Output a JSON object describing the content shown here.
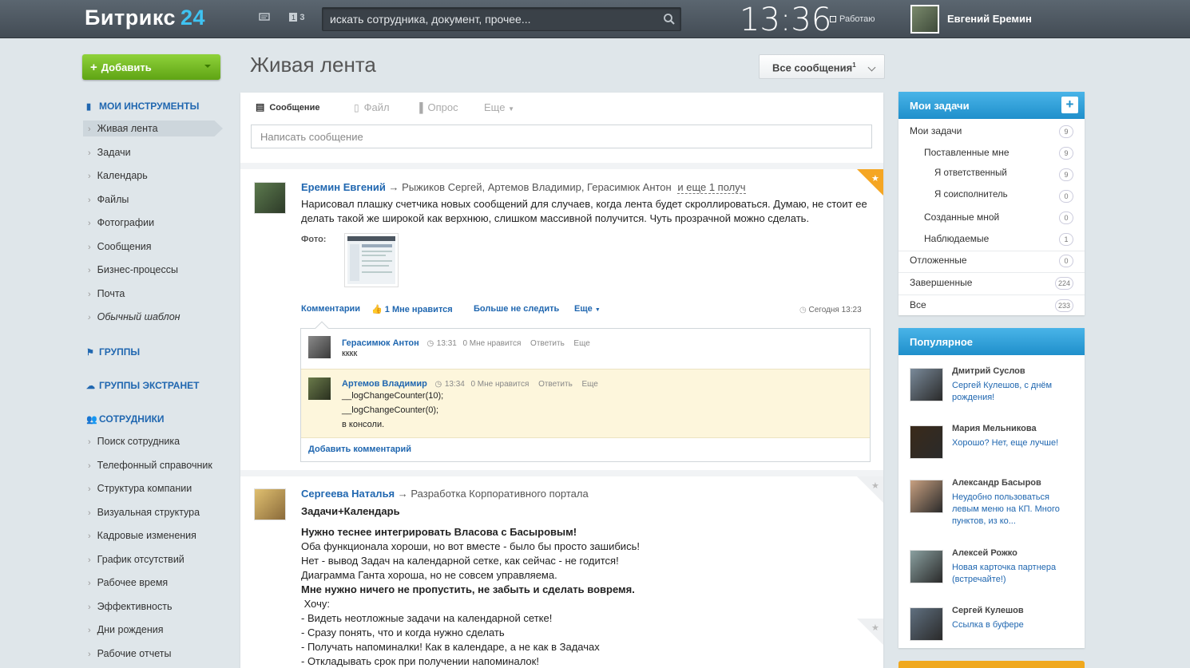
{
  "header": {
    "logo_text": "Битрикс",
    "logo_num": "24",
    "notif_count": "3",
    "search_placeholder": "искать сотрудника, документ, прочее...",
    "clock": "13:36",
    "status": "Работаю",
    "user_name": "Евгений Еремин"
  },
  "sidebar": {
    "add_button": "Добавить",
    "my_tools": "МОИ ИНСТРУМЕНТЫ",
    "tools": [
      "Живая лента",
      "Задачи",
      "Календарь",
      "Файлы",
      "Фотографии",
      "Сообщения",
      "Бизнес-процессы",
      "Почта",
      "Обычный шаблон"
    ],
    "groups": "ГРУППЫ",
    "ext_groups": "ГРУППЫ ЭКСТРАНЕТ",
    "employees": "СОТРУДНИКИ",
    "emp_items": [
      "Поиск сотрудника",
      "Телефонный справочник",
      "Структура компании",
      "Визуальная структура",
      "Кадровые изменения",
      "График отсутствий",
      "Рабочее время",
      "Эффективность",
      "Дни рождения",
      "Рабочие отчеты"
    ]
  },
  "main": {
    "title": "Живая лента",
    "filter_label": "Все сообщения",
    "filter_sup": "1",
    "tabs": [
      "Сообщение",
      "Файл",
      "Опрос",
      "Еще"
    ],
    "input_placeholder": "Написать сообщение"
  },
  "post1": {
    "author": "Еремин Евгений",
    "dest": "Рыжиков Сергей, Артемов Владимир, Герасимюк Антон",
    "more": "и еще 1 получ",
    "text1": "Нарисовал плашку счетчика новых сообщений для случаев, когда лента будет скроллироваться. Думаю, не стоит ее",
    "text2": "делать такой же широкой как верхнюю, слишком массивной получится. Чуть прозрачной можно сделать.",
    "photo_label": "Фото:",
    "comments": "Комментарии",
    "likes": "1",
    "like_label": "Мне нравится",
    "unfollow": "Больше не следить",
    "more_label": "Еще",
    "time": "Сегодня 13:23",
    "c1": {
      "name": "Герасимюк Антон",
      "time": "13:31",
      "likes": "0 Мне нравится",
      "reply": "Ответить",
      "more": "Еще",
      "text": "кккк"
    },
    "c2": {
      "name": "Артемов Владимир",
      "time": "13:34",
      "likes": "0 Мне нравится",
      "reply": "Ответить",
      "more": "Еще",
      "lines": [
        "__logChangeCounter(10);",
        "__logChangeCounter(0);",
        "в консоли."
      ]
    },
    "add_comment": "Добавить комментарий"
  },
  "post2": {
    "author": "Сергеева Наталья",
    "dest": "Разработка Корпоративного портала",
    "subject": "Задачи+Календарь",
    "lines": [
      {
        "t": "Нужно теснее интегрировать Власова с Басыровым!",
        "b": true
      },
      {
        "t": "Оба функционала хороши, но вот вместе - было бы просто зашибись!",
        "b": false
      },
      {
        "t": "Нет - вывод Задач на календарной сетке, как сейчас - не годится!",
        "b": false
      },
      {
        "t": "Диаграмма Ганта хороша, но не совсем управляема.",
        "b": false
      },
      {
        "t": "Мне нужно ничего не пропустить, не забыть и сделать вовремя.",
        "b": true
      },
      {
        "t": " Хочу:",
        "b": false
      },
      {
        "t": "- Видеть неотложные задачи на календарной сетке!",
        "b": false
      },
      {
        "t": "- Сразу понять, что и когда нужно сделать",
        "b": false
      },
      {
        "t": "- Получать напоминалки! Как в календаре, а не как в Задачах",
        "b": false
      },
      {
        "t": "- Откладывать срок при получении напоминалок!",
        "b": false
      }
    ]
  },
  "tasks": {
    "title": "Мои задачи",
    "rows": [
      {
        "label": "Мои задачи",
        "count": "9",
        "indent": 0
      },
      {
        "label": "Поставленные мне",
        "count": "9",
        "indent": 1
      },
      {
        "label": "Я ответственный",
        "count": "9",
        "indent": 2
      },
      {
        "label": "Я соисполнитель",
        "count": "0",
        "indent": 2
      },
      {
        "label": "Созданные мной",
        "count": "0",
        "indent": 1
      },
      {
        "label": "Наблюдаемые",
        "count": "1",
        "indent": 1
      },
      {
        "label": "Отложенные",
        "count": "0",
        "indent": 0
      },
      {
        "label": "Завершенные",
        "count": "224",
        "indent": 0
      },
      {
        "label": "Все",
        "count": "233",
        "indent": 0
      }
    ]
  },
  "popular": {
    "title": "Популярное",
    "items": [
      {
        "name": "Дмитрий Суслов",
        "text": "Сергей Кулешов, с днём рождения!"
      },
      {
        "name": "Мария Мельникова",
        "text": "Хорошо? Нет, еще лучше!"
      },
      {
        "name": "Александр Басыров",
        "text": "Неудобно пользоваться левым меню на КП. Много пунктов, из ко..."
      },
      {
        "name": "Алексей Рожко",
        "text": "Новая карточка партнера (встречайте!)"
      },
      {
        "name": "Сергей Кулешов",
        "text": "Ссылка в буфере"
      }
    ]
  },
  "colors": {
    "accent": "#2067b0",
    "green": "#6cb31f",
    "blue_head": "#2a9ad6",
    "star": "#f5a623"
  }
}
